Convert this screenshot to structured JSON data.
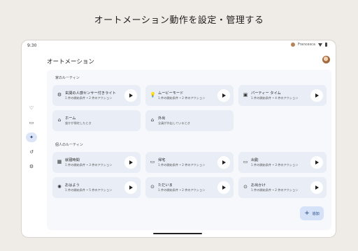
{
  "headline": "オートメーション動作を設定・管理する",
  "status": {
    "time": "9:30",
    "user": "Francesca"
  },
  "app_title": "オートメーション",
  "sections": [
    {
      "label": "家のルーティン",
      "cards": [
        {
          "title": "玄関の人感センサー付きライト",
          "subtitle": "1 件の開始条件 • 2 件のアクション",
          "icon": "sensor-icon",
          "glyph": "⚙",
          "play": true
        },
        {
          "title": "ムービーモード",
          "subtitle": "1 件の開始条件 • 2 件のアクション",
          "icon": "lightbulb-icon",
          "glyph": "💡",
          "play": true
        },
        {
          "title": "パーティー タイム",
          "subtitle": "1 件の開始条件 • 4 件のアクション",
          "icon": "speaker-icon",
          "glyph": "▣",
          "play": true
        },
        {
          "title": "ホーム",
          "subtitle": "誰かが帰宅したとき",
          "icon": "home-icon",
          "glyph": "⌂",
          "play": false
        },
        {
          "title": "外出",
          "subtitle": "全員が外出しているとき",
          "icon": "away-icon",
          "glyph": "⌂",
          "play": false
        }
      ]
    },
    {
      "label": "個人のルーティン",
      "cards": [
        {
          "title": "就寝時間",
          "subtitle": "1 件の開始条件 • 3 件のアクション",
          "icon": "calendar-icon",
          "glyph": "▦",
          "play": true
        },
        {
          "title": "帰宅",
          "subtitle": "1 件の開始条件 • 2 件のアクション",
          "icon": "car-icon",
          "glyph": "▭",
          "play": true
        },
        {
          "title": "出勤",
          "subtitle": "1 件の開始条件 • 3 件のアクション",
          "icon": "work-icon",
          "glyph": "▭",
          "play": true
        },
        {
          "title": "おはよう",
          "subtitle": "1 件の開始条件 • 5 件のアクション",
          "icon": "sun-icon",
          "glyph": "✺",
          "play": true
        },
        {
          "title": "ただいま",
          "subtitle": "1 件の開始条件 • 2 件のアクション",
          "icon": "location-icon",
          "glyph": "⊙",
          "play": true
        },
        {
          "title": "お出かけ",
          "subtitle": "1 件の開始条件 • 2 件のアクション",
          "icon": "location-icon",
          "glyph": "⊙",
          "play": true
        }
      ]
    }
  ],
  "rail": [
    {
      "name": "favorites-icon",
      "glyph": "♡",
      "active": false
    },
    {
      "name": "devices-icon",
      "glyph": "▭",
      "active": false
    },
    {
      "name": "automations-icon",
      "glyph": "✦",
      "active": true
    },
    {
      "name": "activity-icon",
      "glyph": "↺",
      "active": false
    },
    {
      "name": "settings-icon",
      "glyph": "⚙",
      "active": false
    }
  ],
  "fab_label": "追加"
}
